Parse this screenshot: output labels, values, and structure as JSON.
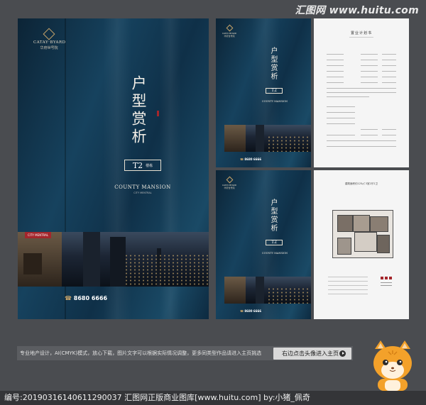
{
  "watermark": "汇图网 www.huitu.com",
  "brochure_main": {
    "brand_en": "CATAY·BYARD",
    "brand_cn": "华府世号院",
    "title_vertical": "户型赏析",
    "type_code": "T2",
    "type_sub": "楼栋",
    "project_en": "COUNTY MANSION",
    "project_sub": "CITY MENTRAL",
    "city_label": "CITY MENTRAL",
    "phone": "8680 6666"
  },
  "brochure_small": {
    "brand_en": "CATAY·BYARD",
    "brand_cn": "华府世号院",
    "title_vertical": "户型赏析",
    "type_code": "T2",
    "project_en": "COUNTY MANSION",
    "phone": "8680 6666"
  },
  "sheet_plan": {
    "title": "置业计划书"
  },
  "sheet_floor": {
    "title": "建筑面积约125㎡  3室2厅2卫"
  },
  "bottom_bar": {
    "description": "专业地产设计，AI(CMYK)模式，放心下载，图片文字可以根据实际情况调整，更多同类型作品请进入主页挑选",
    "button_label": "右边点击头像进入主页"
  },
  "footer": {
    "text": "编号:20190316140611290037  汇图网正版商业图库[www.huitu.com]  by:小猪_佩奇"
  },
  "colors": {
    "navy": "#12344c",
    "background": "#4a4c50",
    "gold": "#c9a56a",
    "accent_red": "#a4262c"
  }
}
